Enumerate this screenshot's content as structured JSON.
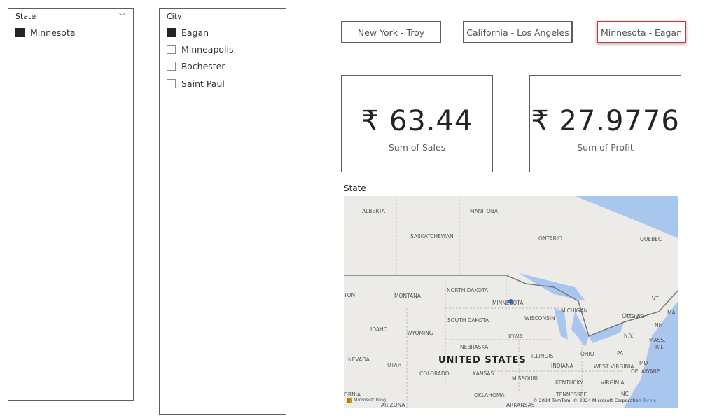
{
  "state_slicer": {
    "title": "State",
    "items": [
      {
        "label": "Minnesota",
        "checked": true
      }
    ]
  },
  "city_slicer": {
    "title": "City",
    "items": [
      {
        "label": "Eagan",
        "checked": true
      },
      {
        "label": "Minneapolis",
        "checked": false
      },
      {
        "label": "Rochester",
        "checked": false
      },
      {
        "label": "Saint Paul",
        "checked": false
      }
    ]
  },
  "bookmarks": [
    {
      "label": "New York - Troy",
      "selected": false
    },
    {
      "label": "California - Los Angeles",
      "selected": false
    },
    {
      "label": "Minnesota - Eagan",
      "selected": true
    }
  ],
  "cards": [
    {
      "value": "₹ 63.44",
      "label": "Sum of Sales"
    },
    {
      "value": "₹ 27.9776",
      "label": "Sum of Profit"
    }
  ],
  "map": {
    "title": "State",
    "country": "UNITED STATES",
    "attribution": "© 2024 TomTom, © 2024 Microsoft Corporation",
    "terms": "Terms",
    "provider": "Microsoft Bing",
    "labels": [
      "ALBERTA",
      "MANITOBA",
      "SASKATCHEWAN",
      "ONTARIO",
      "QUEBEC",
      "NORTH DAKOTA",
      "MONTANA",
      "MINNESOTA",
      "WISCONSIN",
      "SOUTH DAKOTA",
      "IDAHO",
      "WYOMING",
      "IOWA",
      "MICHIGAN",
      "NEBRASKA",
      "ILLINOIS",
      "INDIANA",
      "OHIO",
      "PA",
      "NEVADA",
      "UTAH",
      "COLORADO",
      "KANSAS",
      "MISSOURI",
      "KENTUCKY",
      "WEST VIRGINIA",
      "VIRGINIA",
      "TENNESSEE",
      "OKLAHOMA",
      "ARKANSAS",
      "ARIZONA",
      "Ottawa",
      "N.Y.",
      "NH",
      "VT",
      "MASS.",
      "R.I.",
      "MD",
      "DELAWARE",
      "NC",
      "ORNIA",
      "TON",
      "MA"
    ]
  },
  "colors": {
    "selected_border": "#d13438",
    "water": "#a9c6ee",
    "land": "#ecebe8",
    "point": "#2b6fd6"
  }
}
